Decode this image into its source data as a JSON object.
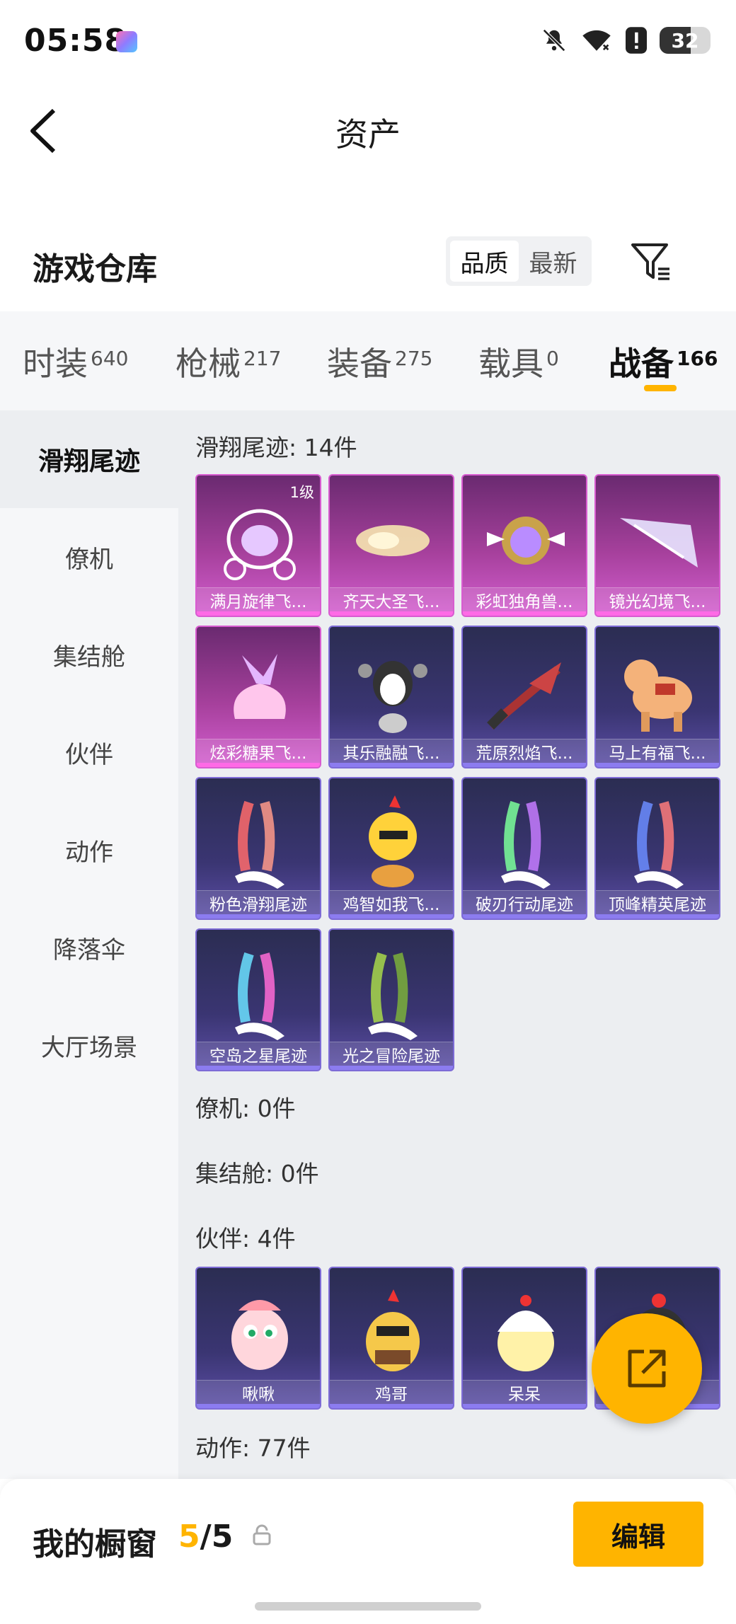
{
  "status_bar": {
    "time": "05:58",
    "battery": "32"
  },
  "header": {
    "title": "资产"
  },
  "warehouse": {
    "title": "游戏仓库",
    "sort_options": [
      "品质",
      "最新"
    ],
    "active_sort": "品质"
  },
  "tabs": [
    {
      "label": "时装",
      "count": "640"
    },
    {
      "label": "枪械",
      "count": "217"
    },
    {
      "label": "装备",
      "count": "275"
    },
    {
      "label": "载具",
      "count": "0"
    },
    {
      "label": "战备",
      "count": "166"
    }
  ],
  "active_tab": "战备",
  "sidebar": {
    "items": [
      "滑翔尾迹",
      "僚机",
      "集结舱",
      "伙伴",
      "动作",
      "降落伞",
      "大厅场景"
    ],
    "active": "滑翔尾迹"
  },
  "sections": {
    "glide_trails": {
      "title": "滑翔尾迹: 14件",
      "items": [
        {
          "name": "满月旋律飞...",
          "level": "1级",
          "rarity": "pink"
        },
        {
          "name": "齐天大圣飞...",
          "rarity": "pink"
        },
        {
          "name": "彩虹独角兽...",
          "rarity": "pink"
        },
        {
          "name": "镜光幻境飞...",
          "rarity": "pink"
        },
        {
          "name": "炫彩糖果飞...",
          "rarity": "pink"
        },
        {
          "name": "其乐融融飞...",
          "rarity": "purple"
        },
        {
          "name": "荒原烈焰飞...",
          "rarity": "purple"
        },
        {
          "name": "马上有福飞...",
          "rarity": "purple"
        },
        {
          "name": "粉色滑翔尾迹",
          "rarity": "purple"
        },
        {
          "name": "鸡智如我飞...",
          "rarity": "purple"
        },
        {
          "name": "破刃行动尾迹",
          "rarity": "purple"
        },
        {
          "name": "顶峰精英尾迹",
          "rarity": "purple"
        },
        {
          "name": "空岛之星尾迹",
          "rarity": "purple"
        },
        {
          "name": "光之冒险尾迹",
          "rarity": "purple"
        }
      ]
    },
    "wingman": {
      "title": "僚机: 0件"
    },
    "capsule": {
      "title": "集结舱: 0件"
    },
    "partner": {
      "title": "伙伴: 4件",
      "items": [
        {
          "name": "啾啾"
        },
        {
          "name": "鸡哥"
        },
        {
          "name": "呆呆"
        },
        {
          "name": ""
        }
      ]
    },
    "emote": {
      "title": "动作: 77件"
    }
  },
  "showcase": {
    "label": "我的橱窗",
    "current": "5",
    "separator": "/",
    "total": "5",
    "edit_label": "编辑"
  },
  "colors": {
    "accent": "#ffb400",
    "rarity_pink": "#d85cd0",
    "rarity_purple": "#7d6bd6"
  }
}
